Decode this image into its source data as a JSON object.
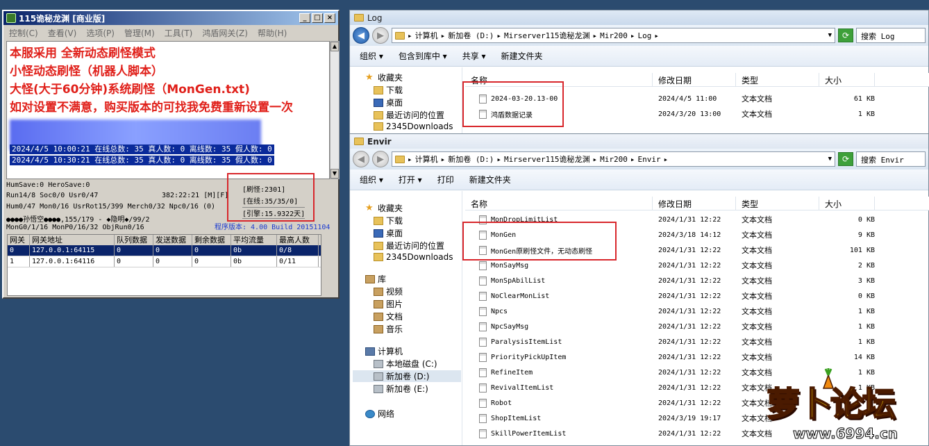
{
  "server": {
    "title": "115诡秘龙渊 [商业版]",
    "window_buttons": [
      "_",
      "□",
      "×"
    ],
    "menu": [
      "控制(C)",
      "查看(V)",
      "选项(P)",
      "管理(M)",
      "工具(T)",
      "鸿盾网关(Z)",
      "帮助(H)"
    ],
    "red_lines": [
      "本服采用 全新动态刷怪模式",
      "小怪动态刷怪（机器人脚本）",
      "大怪(大于60分钟)系统刷怪（MonGen.txt)",
      "如对设置不满意，购买版本的可找我免费重新设置一次"
    ],
    "log_lines": [
      "2024/4/5 10:00:21 在线总数: 35 真人数: 0 离线数: 35 假人数: 0",
      "2024/4/5 10:30:21 在线总数: 35 真人数: 0 离线数: 35 假人数: 0"
    ],
    "stats": [
      "HumSave:0 HeroSave:0",
      "Run14/8 Soc0/0 Usr0/47",
      "Hum0/47 Mon0/16 UsrRot15/399 Merch0/32 Npc0/16 (0)",
      "●●●●孙悟空●●●●,155/179 - ◆隐明◆/99/2",
      "MonG0/1/16 MonP0/16/32 ObjRun0/16"
    ],
    "stats_right": [
      "382:22:21 [M][F]"
    ],
    "status_box": [
      "[刷怪:2301]",
      "[在线:35/35/0]",
      "[引擎:15.9322天]"
    ],
    "version": "程序版本: 4.00 Build 20151104",
    "gateway_headers": [
      "网关",
      "网关地址",
      "队列数据",
      "发送数据",
      "剩余数据",
      "平均流量",
      "最高人数"
    ],
    "gateway_rows": [
      [
        "0",
        "127.0.0.1:64115",
        "0",
        "0",
        "0",
        "0b",
        "0/8"
      ],
      [
        "1",
        "127.0.0.1:64116",
        "0",
        "0",
        "0",
        "0b",
        "0/11"
      ]
    ]
  },
  "log_window": {
    "title": "Log",
    "address": [
      "计算机",
      "新加卷 (D:)",
      "Mirserver115诡秘龙渊",
      "Mir200",
      "Log"
    ],
    "search_placeholder": "搜索 Log",
    "toolbar": [
      "组织 ▾",
      "包含到库中 ▾",
      "共享 ▾",
      "新建文件夹"
    ],
    "nav": [
      "收藏夹",
      "下载",
      "桌面",
      "最近访问的位置",
      "2345Downloads"
    ],
    "columns": [
      "名称",
      "修改日期",
      "类型",
      "大小"
    ],
    "files": [
      {
        "name": "2024-03-20.13-00",
        "date": "2024/4/5 11:00",
        "type": "文本文档",
        "size": "61 KB"
      },
      {
        "name": "鸿盾数据记录",
        "date": "2024/3/20 13:00",
        "type": "文本文档",
        "size": "1 KB"
      }
    ]
  },
  "envir_window": {
    "title": "Envir",
    "address": [
      "计算机",
      "新加卷 (D:)",
      "Mirserver115诡秘龙渊",
      "Mir200",
      "Envir"
    ],
    "search_placeholder": "搜索 Envir",
    "toolbar": [
      "组织 ▾",
      "打开 ▾",
      "打印",
      "新建文件夹"
    ],
    "nav": [
      "收藏夹",
      "下载",
      "桌面",
      "最近访问的位置",
      "2345Downloads",
      "库",
      "视频",
      "图片",
      "文档",
      "音乐",
      "计算机",
      "本地磁盘 (C:)",
      "新加卷 (D:)",
      "新加卷 (E:)",
      "网络"
    ],
    "columns": [
      "名称",
      "修改日期",
      "类型",
      "大小"
    ],
    "files": [
      {
        "name": "MonDropLimitList",
        "date": "2024/1/31 12:22",
        "type": "文本文档",
        "size": "0 KB"
      },
      {
        "name": "MonGen",
        "date": "2024/3/18 14:12",
        "type": "文本文档",
        "size": "9 KB"
      },
      {
        "name": "MonGen原刷怪文件，无动态刷怪",
        "date": "2024/1/31 12:22",
        "type": "文本文档",
        "size": "101 KB"
      },
      {
        "name": "MonSayMsg",
        "date": "2024/1/31 12:22",
        "type": "文本文档",
        "size": "2 KB"
      },
      {
        "name": "MonSpAbilList",
        "date": "2024/1/31 12:22",
        "type": "文本文档",
        "size": "3 KB"
      },
      {
        "name": "NoClearMonList",
        "date": "2024/1/31 12:22",
        "type": "文本文档",
        "size": "0 KB"
      },
      {
        "name": "Npcs",
        "date": "2024/1/31 12:22",
        "type": "文本文档",
        "size": "1 KB"
      },
      {
        "name": "NpcSayMsg",
        "date": "2024/1/31 12:22",
        "type": "文本文档",
        "size": "1 KB"
      },
      {
        "name": "ParalysisItemList",
        "date": "2024/1/31 12:22",
        "type": "文本文档",
        "size": "1 KB"
      },
      {
        "name": "PriorityPickUpItem",
        "date": "2024/1/31 12:22",
        "type": "文本文档",
        "size": "14 KB"
      },
      {
        "name": "RefineItem",
        "date": "2024/1/31 12:22",
        "type": "文本文档",
        "size": "1 KB"
      },
      {
        "name": "RevivalItemList",
        "date": "2024/1/31 12:22",
        "type": "文本文档",
        "size": "1 KB"
      },
      {
        "name": "Robot",
        "date": "2024/1/31 12:22",
        "type": "文本文档",
        "size": ""
      },
      {
        "name": "ShopItemList",
        "date": "2024/3/19 19:17",
        "type": "文本文档",
        "size": ""
      },
      {
        "name": "SkillPowerItemList",
        "date": "2024/1/31 12:22",
        "type": "文本文档",
        "size": ""
      }
    ]
  },
  "watermark": {
    "text": "萝卜论坛",
    "url": "www.6994.cn"
  }
}
